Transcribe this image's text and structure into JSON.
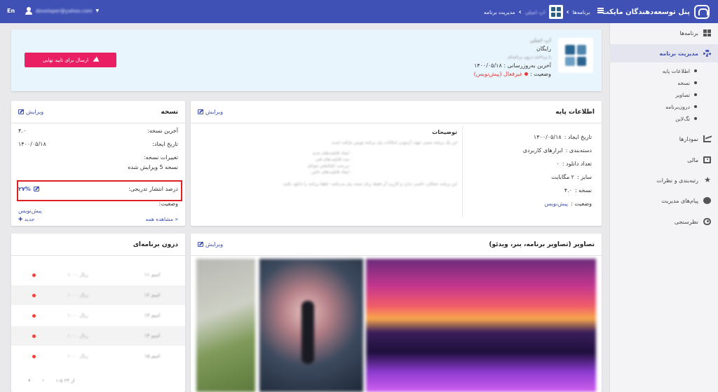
{
  "topbar": {
    "brand_title": "پنل توسعه‌دهندگان مایکت",
    "breadcrumb_programs": "برنامه‌ها",
    "breadcrumb_app": "اپ اصلی",
    "breadcrumb_current": "مدیریت برنامه",
    "user_email": "developer@yahoo.com",
    "language": "En"
  },
  "sidebar": {
    "items": [
      {
        "label": "برنامه‌ها",
        "icon": "grid-icon"
      },
      {
        "label": "مدیریت برنامه",
        "icon": "gear-icon",
        "active": true
      },
      {
        "label": "نمودارها",
        "icon": "chart-icon"
      },
      {
        "label": "مالی",
        "icon": "money-icon"
      },
      {
        "label": "رتبه‌بندی و نظرات",
        "icon": "star-icon"
      },
      {
        "label": "پیام‌های مدیریت",
        "icon": "chat-icon"
      },
      {
        "label": "نظرسنجی",
        "icon": "eye-icon"
      }
    ],
    "sub_items": [
      "اطلاعات پایه",
      "نسخه",
      "تصاویر",
      "درون‌برنامه",
      "تگ‌لاین"
    ]
  },
  "hero": {
    "app_name": "اپ اصلی",
    "price": "رایگان",
    "price_note": "با پرداخت درون برنامه‌ای",
    "updated_label": "آخرین به‌روزرسانی :",
    "updated_value": "۱۴۰۰/۰۵/۱۸",
    "status_label": "وضعیت :",
    "status_value": "غیرفعال (پیش‌نویس)",
    "submit_label": "ارسال برای تایید نهایی"
  },
  "basic_info": {
    "title": "اطلاعات پایه",
    "edit_label": "ویرایش",
    "fields": [
      {
        "label": "تاریخ ایجاد :",
        "value": "۱۴۰۰/۰۵/۱۸"
      },
      {
        "label": "دسته‌بندی :",
        "value": "ابزارهای کاربردی"
      },
      {
        "label": "تعداد دانلود :",
        "value": "۰"
      },
      {
        "label": "سایز :",
        "value": "۲ مگابایت"
      },
      {
        "label": "نسخه :",
        "value": "۴.۰"
      },
      {
        "label": "وضعیت :",
        "value": "پیش‌نویس"
      }
    ],
    "description_title": "توضیحات",
    "description_lines": [
      "این یک برنامه تستی جهت آزمودن امکانات پنل برنامه نویس مایکت است",
      "- ایجاد قابلیت‌های جدید",
      "- ثبت قابلیت‌های فنی",
      "- بررسی اپلیکیشن موبایل",
      "- ایجاد قابلیت‌های خاص",
      "این برنامه عملکرد خاصی ندارد و کاربرد آن فقط برای تست پنل می‌باشد. لطفا برنامه را دانلود نکنید."
    ]
  },
  "version": {
    "title": "نسخه",
    "edit_label": "ویرایش",
    "last_version_label": "آخرین نسخه:",
    "last_version_value": "۴.۰",
    "created_label": "تاریخ ایجاد:",
    "created_value": "۱۴۰۰/۰۵/۱۸",
    "changes_label": "تغییرات نسخه:",
    "changes_value": "نسخه 5 ویرایش شده",
    "rollout_label": "درصد انتشار تدریجی:",
    "rollout_value": "۲۷%",
    "status_label": "وضعیت:",
    "status_value": "پیش‌نویس",
    "see_all": "مشاهده همه »",
    "new_label": "جدید"
  },
  "in_app": {
    "title": "درون برنامه‌ای",
    "rows": [
      {
        "name": "اسم ۱۱",
        "price": "۱۰۰۰ ریال"
      },
      {
        "name": "اسم ۱۲",
        "price": "۱۰۰۰ ریال"
      },
      {
        "name": "اسم ۱۳",
        "price": "۱۰۰۰ ریال"
      },
      {
        "name": "اسم ۱۴",
        "price": "۱۰۰۰ ریال"
      },
      {
        "name": "اسم ۱۵",
        "price": "۱۰۰۰ ریال"
      }
    ],
    "pager_text": "۱-۵ از ۲۳"
  },
  "images": {
    "title": "تصاویر (تصاویر برنامه، بنر، ویدئو)",
    "edit_label": "ویرایش"
  },
  "colors": {
    "topbar": "#3f51b5",
    "accent_pink": "#e91e63",
    "status_red": "#e53935",
    "highlight_box": "#e02020"
  }
}
